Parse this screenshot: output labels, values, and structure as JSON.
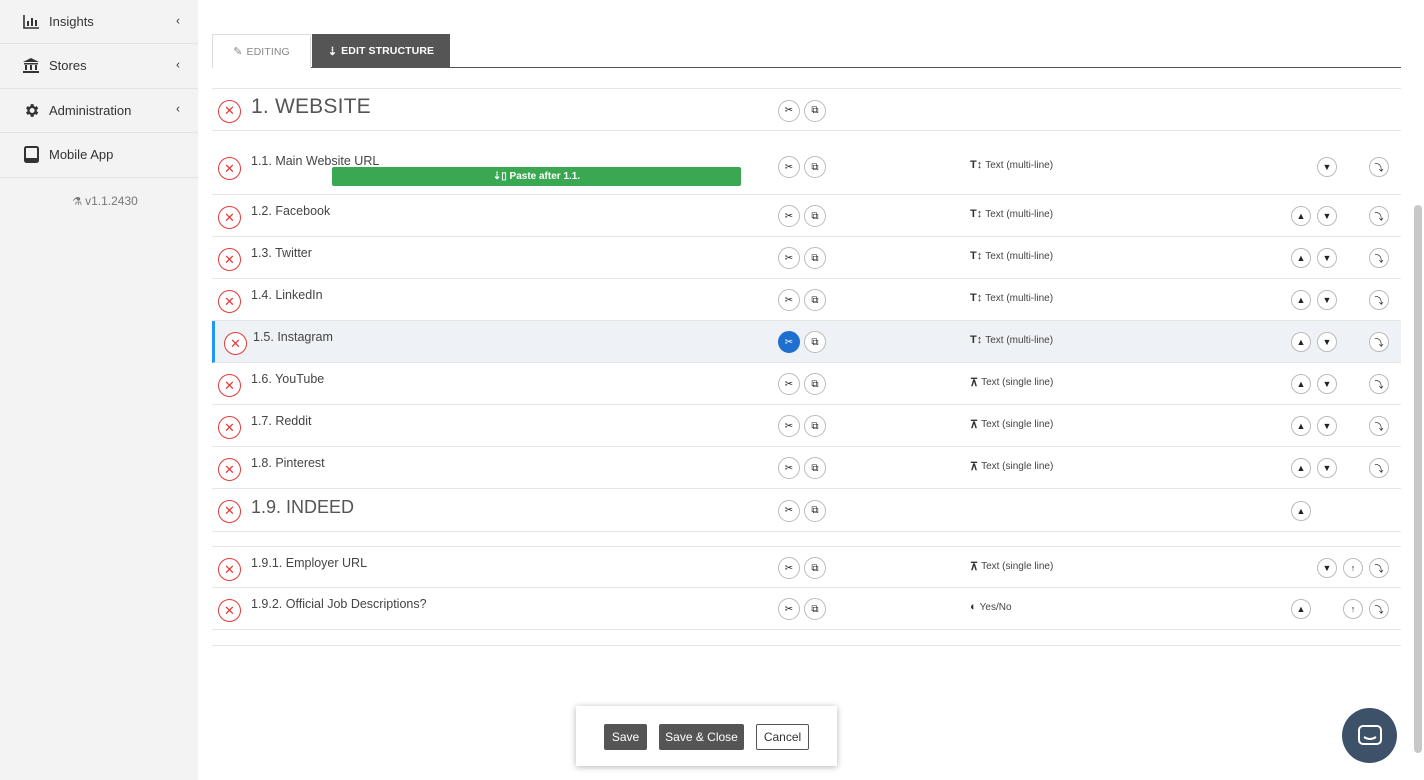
{
  "sidebar": {
    "items": [
      {
        "label": "Insights",
        "icon": "bar-chart-icon",
        "glyph": "📊",
        "chevron": "‹"
      },
      {
        "label": "Stores",
        "icon": "bank-icon",
        "glyph": "🏛",
        "chevron": "‹"
      },
      {
        "label": "Administration",
        "icon": "gear-icon",
        "glyph": "⚙",
        "chevron": "‹"
      },
      {
        "label": "Mobile App",
        "icon": "tablet-icon",
        "glyph": "▭",
        "chevron": ""
      }
    ],
    "version": "v1.1.2430"
  },
  "tabs": {
    "editing": "EDITING",
    "edit_structure": "EDIT STRUCTURE"
  },
  "rows": [
    {
      "label": "1. WEBSITE",
      "type": ""
    },
    {
      "label": "1.1. Main Website URL",
      "type": "Text (multi-line)"
    },
    {
      "label": "1.2. Facebook",
      "type": "Text (multi-line)"
    },
    {
      "label": "1.3. Twitter",
      "type": "Text (multi-line)"
    },
    {
      "label": "1.4. LinkedIn",
      "type": "Text (multi-line)"
    },
    {
      "label": "1.5. Instagram",
      "type": "Text (multi-line)"
    },
    {
      "label": "1.6. YouTube",
      "type": "Text (single line)"
    },
    {
      "label": "1.7. Reddit",
      "type": "Text (single line)"
    },
    {
      "label": "1.8. Pinterest",
      "type": "Text (single line)"
    },
    {
      "label": "1.9. INDEED",
      "type": ""
    },
    {
      "label": "1.9.1. Employer URL",
      "type": "Text (single line)"
    },
    {
      "label": "1.9.2. Official Job Descriptions?",
      "type": "Yes/No"
    }
  ],
  "paste_bar": "Paste after 1.1.",
  "footer": {
    "save": "Save",
    "save_close": "Save & Close",
    "cancel": "Cancel"
  },
  "colors": {
    "accent_dark": "#555555",
    "delete_red": "#e53935",
    "paste_green": "#3aa852",
    "selected_blue": "#2196f3",
    "chat_bg": "#3d5268"
  }
}
